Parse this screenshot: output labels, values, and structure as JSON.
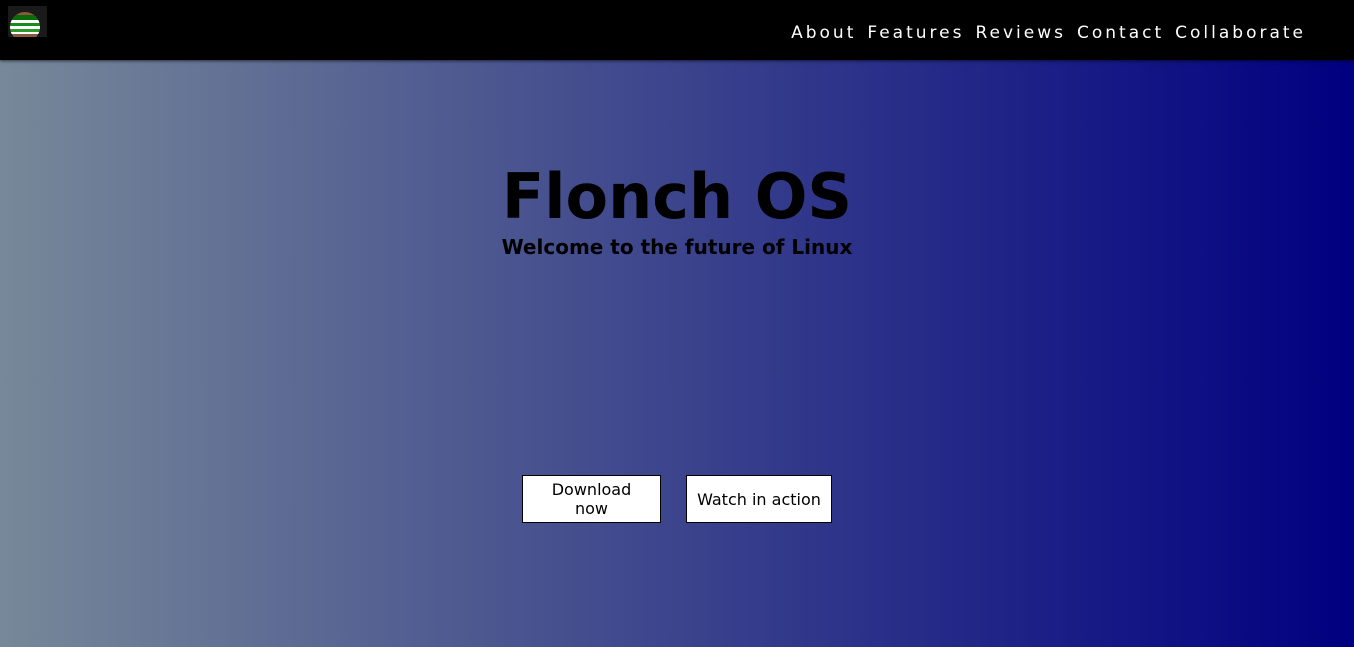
{
  "navbar": {
    "logo_icon": "flonch-logo-icon",
    "links": [
      "About",
      "Features",
      "Reviews",
      "Contact",
      "Collaborate"
    ]
  },
  "hero": {
    "title": "Flonch OS",
    "subtitle": "Welcome to the future of Linux",
    "buttons": {
      "download_label": "Download now",
      "watch_label": "Watch in action"
    }
  },
  "colors": {
    "navbar_bg": "#000000",
    "gradient_start": "#778899",
    "gradient_end": "#000080",
    "button_bg": "#ffffff",
    "text": "#000000"
  }
}
